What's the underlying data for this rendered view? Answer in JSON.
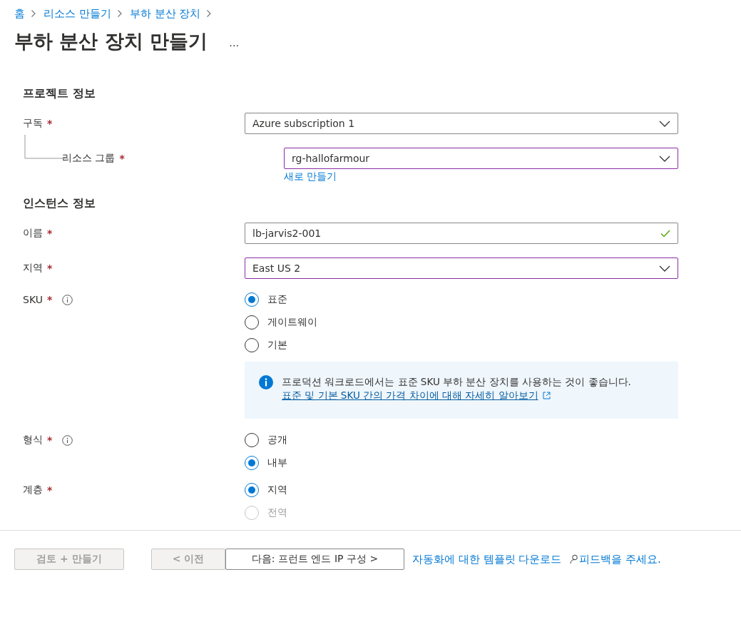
{
  "breadcrumb": [
    "홈",
    "리소스 만들기",
    "부하 분산 장치"
  ],
  "title": "부하 분산 장치 만들기",
  "more": "…",
  "sections": [
    {
      "heading": "프로젝트 정보",
      "fields": [
        {
          "kind": "select",
          "label": "구독",
          "required": "*",
          "value": "Azure subscription 1",
          "changed": false
        },
        {
          "kind": "select",
          "label": "리소스 그룹",
          "required": "*",
          "nested": true,
          "value": "rg-hallofarmour",
          "changed": true,
          "link": "새로 만들기"
        }
      ]
    },
    {
      "heading": "인스턴스 정보",
      "fields": [
        {
          "kind": "text",
          "label": "이름",
          "required": "*",
          "value": "lb-jarvis2-001",
          "changed": false,
          "valid": true
        },
        {
          "kind": "select",
          "label": "지역",
          "required": "*",
          "value": "East US 2",
          "changed": true
        },
        {
          "kind": "radio",
          "label": "SKU",
          "required": "*",
          "info": true,
          "options": [
            {
              "label": "표준",
              "selected": true,
              "disabled": false
            },
            {
              "label": "게이트웨이",
              "selected": false,
              "disabled": false
            },
            {
              "label": "기본",
              "selected": false,
              "disabled": false
            }
          ],
          "notice": {
            "text": "프로덕션 워크로드에서는 표준 SKU 부하 분산 장치를 사용하는 것이 좋습니다.",
            "link": "표준 및 기본 SKU 간의 가격 차이에 대해 자세히 알아보기"
          }
        },
        {
          "kind": "radio",
          "label": "형식",
          "required": "*",
          "info": true,
          "options": [
            {
              "label": "공개",
              "selected": false,
              "disabled": false
            },
            {
              "label": "내부",
              "selected": true,
              "disabled": false
            }
          ]
        },
        {
          "kind": "radio",
          "label": "계층",
          "required": "*",
          "options": [
            {
              "label": "지역",
              "selected": true,
              "disabled": false
            },
            {
              "label": "전역",
              "selected": false,
              "disabled": true
            }
          ]
        }
      ]
    }
  ],
  "footer": {
    "buttons": [
      {
        "label": "검토 + 만들기",
        "disabled": true
      },
      {
        "label": "< 이전",
        "disabled": true
      },
      {
        "label": "다음: 프런트 엔드 IP 구성 >",
        "disabled": false
      }
    ],
    "template_link": "자동화에 대한 템플릿 다운로드",
    "feedback": "피드백을 주세요."
  }
}
